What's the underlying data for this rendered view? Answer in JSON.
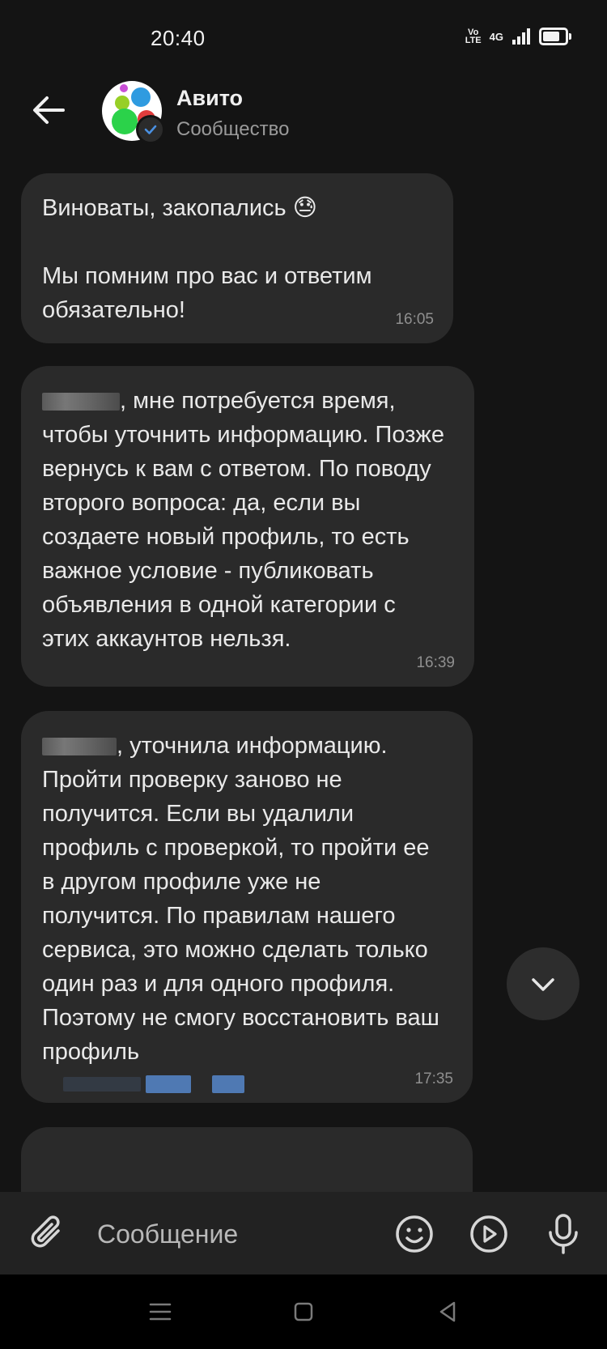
{
  "status_bar": {
    "time": "20:40",
    "volte_top": "Vo",
    "volte_bottom": "LTE",
    "network": "4G"
  },
  "header": {
    "title": "Авито",
    "subtitle": "Сообщество"
  },
  "messages": [
    {
      "text_before": "Виноваты, закопались ",
      "emoji": "😓",
      "text_after": "\n\nМы помним про вас и ответим обязательно!",
      "time": "16:05"
    },
    {
      "text": ", мне потребуется время, чтобы уточнить информацию. Позже вернусь к вам с ответом. По поводу второго вопроса: да, если вы создаете новый профиль, то есть важное условие - публиковать объявления в одной категории с этих аккаунтов нельзя.",
      "time": "16:39"
    },
    {
      "text": ", уточнила информацию. Пройти проверку заново не получится. Если вы удалили профиль с проверкой, то пройти ее в другом профиле уже не получится. По правилам нашего сервиса, это можно сделать только один раз и для одного профиля. Поэтому не смогу восстановить ваш профиль",
      "time": "17:35"
    }
  ],
  "composer": {
    "placeholder": "Сообщение"
  },
  "icons": {
    "back": "arrow-left-icon",
    "attach": "paperclip-icon",
    "emoji": "smile-icon",
    "video": "play-circle-icon",
    "mic": "microphone-icon",
    "scroll": "chevron-down-icon"
  },
  "colors": {
    "background": "#141414",
    "bubble": "#2a2a2a",
    "composer": "#222222",
    "accent_blue": "#4f79b3"
  }
}
